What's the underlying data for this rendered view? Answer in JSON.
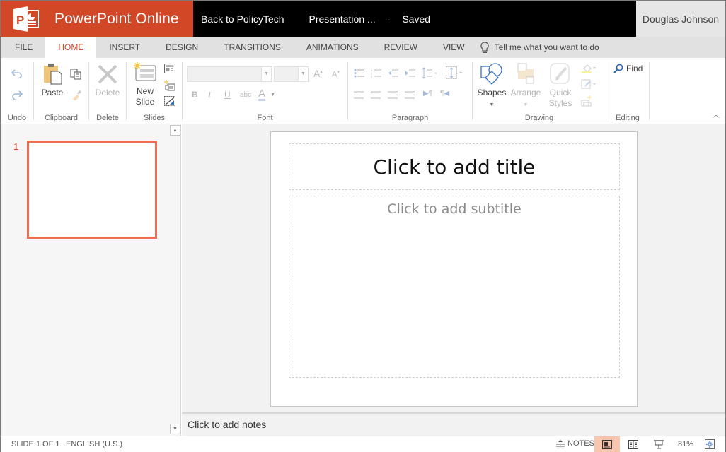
{
  "app": {
    "name": "PowerPoint Online",
    "brand_color": "#d24726",
    "logo_icon": "powerpoint-logo-icon"
  },
  "titlebar": {
    "back_link": "Back to PolicyTech",
    "document_name": "Presentation ...",
    "separator": "-",
    "save_status": "Saved",
    "user_name": "Douglas Johnson"
  },
  "tabs": [
    {
      "label": "FILE",
      "active": false
    },
    {
      "label": "HOME",
      "active": true
    },
    {
      "label": "INSERT",
      "active": false
    },
    {
      "label": "DESIGN",
      "active": false
    },
    {
      "label": "TRANSITIONS",
      "active": false
    },
    {
      "label": "ANIMATIONS",
      "active": false
    },
    {
      "label": "REVIEW",
      "active": false
    },
    {
      "label": "VIEW",
      "active": false
    }
  ],
  "tell_me": {
    "placeholder": "Tell me what you want to do",
    "icon": "lightbulb-icon"
  },
  "ribbon": {
    "groups": {
      "undo": {
        "label": "Undo",
        "undo_icon": "undo-icon",
        "redo_icon": "redo-icon"
      },
      "clipboard": {
        "label": "Clipboard",
        "paste": "Paste",
        "copy_icon": "copy-icon",
        "format_painter_icon": "format-painter-icon"
      },
      "delete": {
        "label": "Delete",
        "delete": "Delete"
      },
      "slides": {
        "label": "Slides",
        "new_slide_line1": "New",
        "new_slide_line2": "Slide",
        "layout_icon": "layout-icon",
        "duplicate_icon": "duplicate-slide-icon",
        "hide_icon": "hide-slide-icon"
      },
      "font": {
        "label": "Font",
        "font_name": "",
        "font_size": "",
        "bold": "B",
        "italic": "I",
        "underline": "U",
        "strike": "abc",
        "font_color": "A",
        "grow": "A",
        "shrink": "A"
      },
      "paragraph": {
        "label": "Paragraph"
      },
      "drawing": {
        "label": "Drawing",
        "shapes": "Shapes",
        "arrange": "Arrange",
        "quick_styles_line1": "Quick",
        "quick_styles_line2": "Styles"
      },
      "editing": {
        "label": "Editing",
        "find": "Find"
      }
    }
  },
  "thumbnails": [
    {
      "number": "1",
      "selected": true
    }
  ],
  "slide": {
    "title_placeholder": "Click to add title",
    "subtitle_placeholder": "Click to add subtitle"
  },
  "notes": {
    "placeholder": "Click to add notes"
  },
  "statusbar": {
    "slide_counter": "SLIDE 1 OF 1",
    "language": "ENGLISH (U.S.)",
    "notes_label": "NOTES",
    "zoom": "81%",
    "active_view": "normal",
    "accent_active_view": "#f8c5ae"
  }
}
